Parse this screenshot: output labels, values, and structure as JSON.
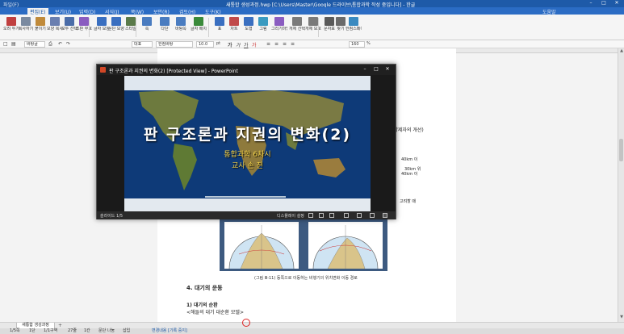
{
  "window": {
    "title": "새통합 생성과정.hwp [C:\\Users\\Master\\Google 드라이브\\통합과학 작성 중입니다] - 한글",
    "quick_access": "파일(F)",
    "help_label": "도움말",
    "minimize": "–",
    "maximize": "□",
    "close": "✕"
  },
  "menu": {
    "items": [
      {
        "label": "편집(E)",
        "active": true
      },
      {
        "label": "보기(U)",
        "active": false
      },
      {
        "label": "입력(D)",
        "active": false
      },
      {
        "label": "서식(J)",
        "active": false
      },
      {
        "label": "쪽(W)",
        "active": false
      },
      {
        "label": "보안(R)",
        "active": false
      },
      {
        "label": "검토(H)",
        "active": false
      },
      {
        "label": "도구(K)",
        "active": false
      }
    ]
  },
  "ribbon": {
    "buttons": [
      {
        "name": "cut-button",
        "label": "오려 두기",
        "color": "#c04040"
      },
      {
        "name": "copy-button",
        "label": "복사하기",
        "color": "#7a8aa0"
      },
      {
        "name": "paste-button",
        "label": "붙이기",
        "color": "#c08a3a"
      },
      {
        "name": "format-copy-button",
        "label": "모양 복사",
        "color": "#6a7fb0"
      },
      {
        "name": "select-all-button",
        "label": "모두 선택",
        "color": "#4a6ca8"
      },
      {
        "name": "find-button",
        "label": "조판 부호",
        "color": "#8a5cc0"
      },
      {
        "name": "char-shape-button",
        "label": "글자 모양",
        "color": "#3a6fc0"
      },
      {
        "name": "para-shape-button",
        "label": "문단 모양",
        "color": "#3a6fc0"
      },
      {
        "name": "style-button",
        "label": "스타일",
        "color": "#5a7a4a"
      },
      {
        "name": "layout-button",
        "label": "쪽",
        "color": "#4a7cc0"
      },
      {
        "name": "multi-column-button",
        "label": "다단",
        "color": "#4a7cc0"
      },
      {
        "name": "text-box-button",
        "label": "바탕쪽",
        "color": "#4a7cc0"
      },
      {
        "name": "wrap-button",
        "label": "글자 배치",
        "color": "#3a8a3a"
      },
      {
        "name": "table-button",
        "label": "표",
        "color": "#3a6fc0"
      },
      {
        "name": "chart-button",
        "label": "차트",
        "color": "#c04a4a"
      },
      {
        "name": "shape-button",
        "label": "도형",
        "color": "#3a6fc0"
      },
      {
        "name": "picture-button",
        "label": "그림",
        "color": "#3a9ac0"
      },
      {
        "name": "drawing-button",
        "label": "그리기마당",
        "color": "#8a5cc0"
      },
      {
        "name": "object-select-button",
        "label": "개체 선택",
        "color": "#7a7a7a"
      },
      {
        "name": "object-protect-button",
        "label": "개체 보호",
        "color": "#7a7a7a"
      },
      {
        "name": "special-char-button",
        "label": "문자표",
        "color": "#5a5a5a"
      },
      {
        "name": "find-replace-button",
        "label": "찾기",
        "color": "#6a6a6a"
      },
      {
        "name": "hancom-button",
        "label": "한컴스페이스",
        "color": "#3a8ac0"
      }
    ]
  },
  "format_bar": {
    "style_select": "바탕글",
    "lang_select": "대표",
    "font_select": "한컴바탕",
    "font_size": "10.0",
    "unit": "pt",
    "zoom": "160",
    "zoom_unit": "%"
  },
  "document": {
    "right_note": "(약제자의 개선)",
    "section_heading": "4. 대기의 운동",
    "sub_heading": "1) 대기의 순환",
    "sub_text": "<해들의 대기 대순환 모델>",
    "caption": "(그림 Ⅲ-11) 동쪽으로 이동하는 비행기의 위치변화 이동 경로",
    "side_labels": [
      "40km 이",
      "30km 위",
      "40km 이"
    ],
    "side_note": "고려할 때"
  },
  "ppt": {
    "title": "판 구조론과 지권의 변화(2) [Protected View] - PowerPoint",
    "slide_title": "판 구조론과 지권의 변화(2)",
    "slide_subtitle": "통합과학 6차시",
    "slide_teacher": "교사 손 진",
    "slide_counter": "슬라이드 1/5",
    "display_settings": "디스플레이 설정",
    "colors": {
      "title_bar": "#202020",
      "accent": "#d24726",
      "subtitle": "#f4d34a"
    }
  },
  "tab_bar": {
    "tab_label": "새통합 생성과정"
  },
  "status_bar": {
    "items": [
      "1/5쪽",
      "1단",
      "1/1구역",
      "27줄",
      "1칸",
      "문단 나눔",
      "삽입",
      "변경내용 [기록 중지]"
    ]
  }
}
